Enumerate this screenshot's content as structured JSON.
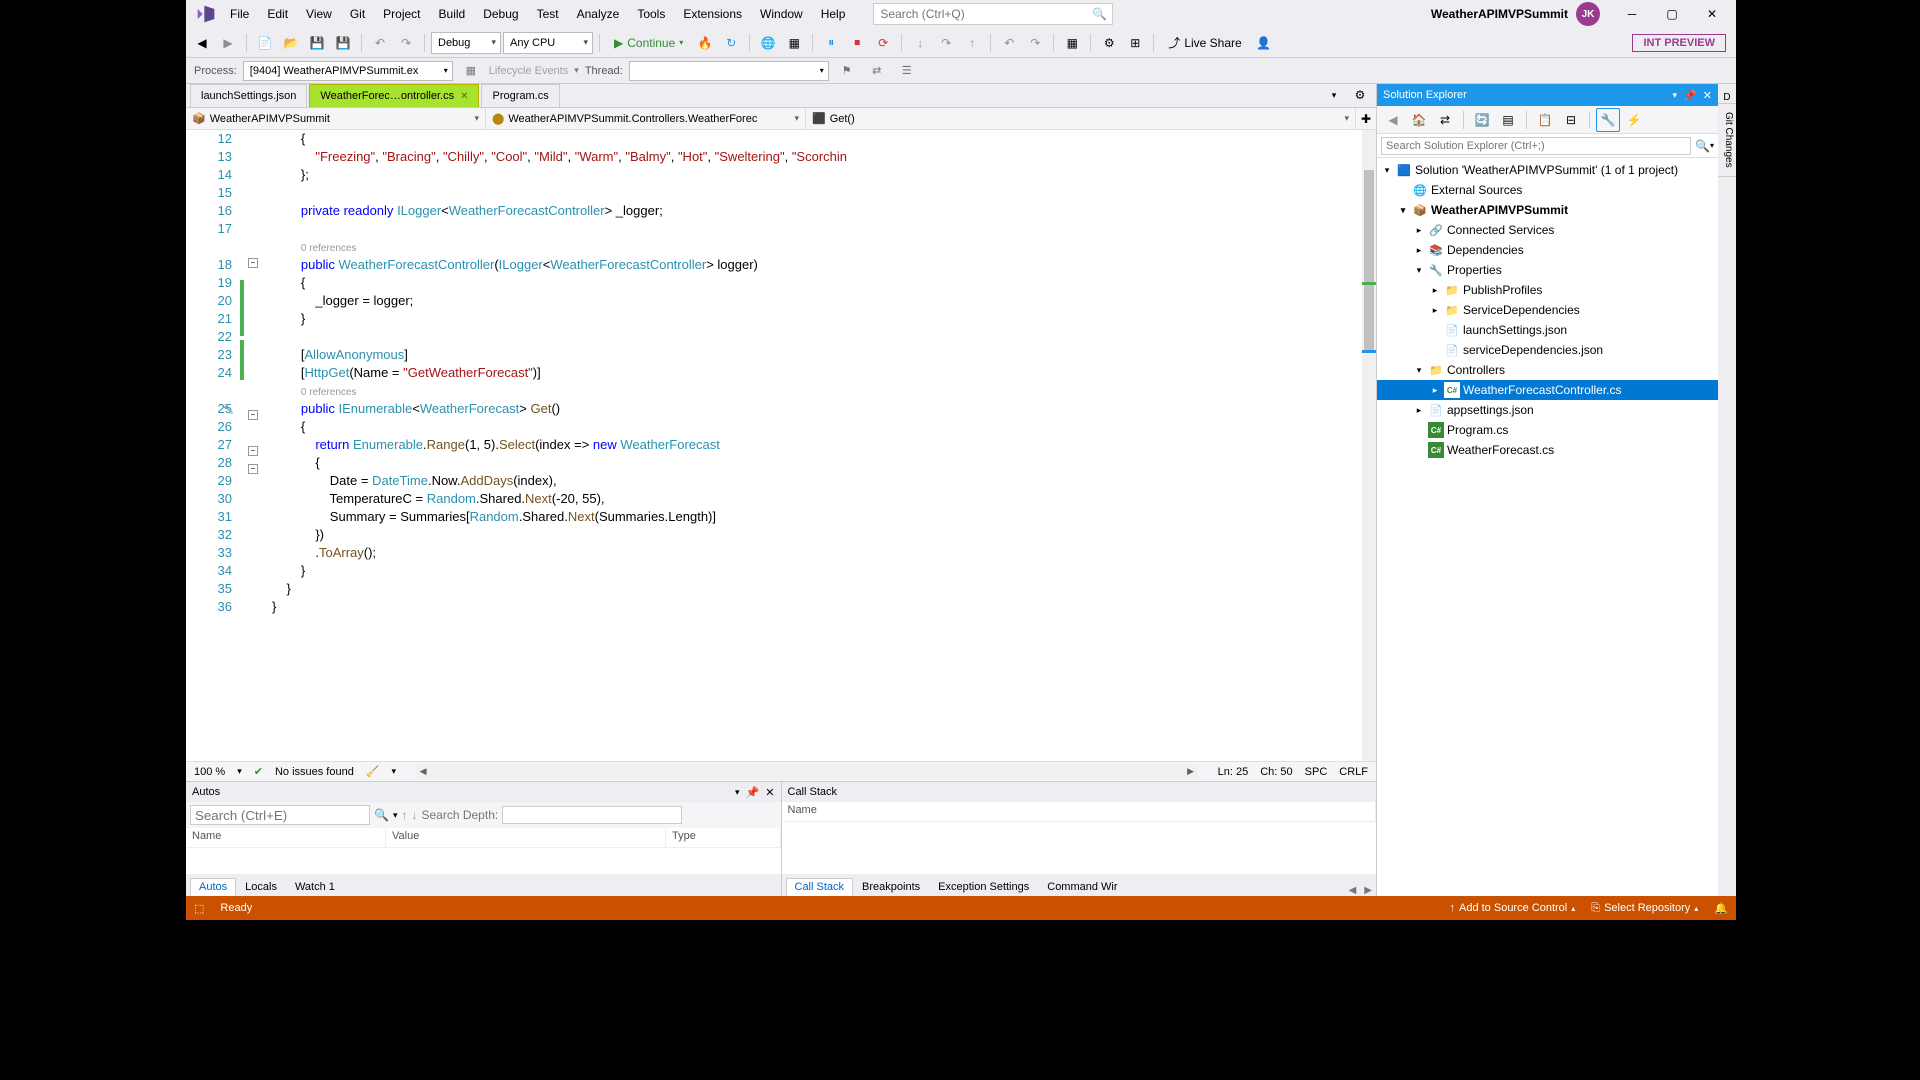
{
  "title": {
    "solution_display": "WeatherAPIMVPSummit",
    "user_initials": "JK"
  },
  "menus": [
    "File",
    "Edit",
    "View",
    "Git",
    "Project",
    "Build",
    "Debug",
    "Test",
    "Analyze",
    "Tools",
    "Extensions",
    "Window",
    "Help"
  ],
  "search": {
    "placeholder": "Search (Ctrl+Q)"
  },
  "toolbar": {
    "config": "Debug",
    "platform": "Any CPU",
    "continue": "Continue",
    "live_share": "Live Share",
    "int_preview": "INT PREVIEW"
  },
  "debugbar": {
    "process_label": "Process:",
    "process": "[9404] WeatherAPIMVPSummit.ex",
    "lifecycle": "Lifecycle Events",
    "thread_label": "Thread:"
  },
  "tabs": [
    {
      "label": "launchSettings.json",
      "active": false
    },
    {
      "label": "WeatherForec…ontroller.cs",
      "active": true
    },
    {
      "label": "Program.cs",
      "active": false
    }
  ],
  "navbar": {
    "scope": "WeatherAPIMVPSummit",
    "type": "WeatherAPIMVPSummit.Controllers.WeatherForec",
    "member": "Get()"
  },
  "code": {
    "lines": [
      {
        "n": 12,
        "html": "        {"
      },
      {
        "n": 13,
        "html": "            <span class='str'>\"Freezing\"</span>, <span class='str'>\"Bracing\"</span>, <span class='str'>\"Chilly\"</span>, <span class='str'>\"Cool\"</span>, <span class='str'>\"Mild\"</span>, <span class='str'>\"Warm\"</span>, <span class='str'>\"Balmy\"</span>, <span class='str'>\"Hot\"</span>, <span class='str'>\"Sweltering\"</span>, <span class='str'>\"Scorchin</span>"
      },
      {
        "n": 14,
        "html": "        };"
      },
      {
        "n": 15,
        "html": ""
      },
      {
        "n": 16,
        "html": "        <span class='kw'>private</span> <span class='kw'>readonly</span> <span class='type'>ILogger</span>&lt;<span class='type'>WeatherForecastController</span>&gt; _logger;"
      },
      {
        "n": 17,
        "html": ""
      },
      {
        "n": "",
        "html": "        <span class='ref'>0 references</span>"
      },
      {
        "n": 18,
        "html": "        <span class='kw'>public</span> <span class='type'>WeatherForecastController</span>(<span class='type'>ILogger</span>&lt;<span class='type'>WeatherForecastController</span>&gt; logger)"
      },
      {
        "n": 19,
        "html": "        {"
      },
      {
        "n": 20,
        "html": "            _logger = logger;"
      },
      {
        "n": 21,
        "html": "        }"
      },
      {
        "n": 22,
        "html": ""
      },
      {
        "n": 23,
        "html": "        [<span class='type'>AllowAnonymous</span>]"
      },
      {
        "n": 24,
        "html": "        [<span class='type'>HttpGet</span>(Name = <span class='str'>\"GetWeatherForecast\"</span>)]"
      },
      {
        "n": "",
        "html": "        <span class='ref'>0 references</span>"
      },
      {
        "n": 25,
        "html": "        <span class='kw'>public</span> <span class='type'>IEnumerable</span>&lt;<span class='type'>WeatherForecast</span>&gt; <span class='method'>Get</span>()"
      },
      {
        "n": 26,
        "html": "        {"
      },
      {
        "n": 27,
        "html": "            <span class='kw'>return</span> <span class='type'>Enumerable</span>.<span class='method'>Range</span>(1, 5).<span class='method'>Select</span>(index =&gt; <span class='kw'>new</span> <span class='type'>WeatherForecast</span>"
      },
      {
        "n": 28,
        "html": "            {"
      },
      {
        "n": 29,
        "html": "                Date = <span class='type'>DateTime</span>.Now.<span class='method'>AddDays</span>(index),"
      },
      {
        "n": 30,
        "html": "                TemperatureC = <span class='type'>Random</span>.Shared.<span class='method'>Next</span>(-20, 55),"
      },
      {
        "n": 31,
        "html": "                Summary = Summaries[<span class='type'>Random</span>.Shared.<span class='method'>Next</span>(Summaries.Length)]"
      },
      {
        "n": 32,
        "html": "            })"
      },
      {
        "n": 33,
        "html": "            .<span class='method'>ToArray</span>();"
      },
      {
        "n": 34,
        "html": "        }"
      },
      {
        "n": 35,
        "html": "    }"
      },
      {
        "n": 36,
        "html": "}"
      }
    ]
  },
  "editor_status": {
    "zoom": "100 %",
    "issues": "No issues found",
    "ln": "Ln: 25",
    "ch": "Ch: 50",
    "spc": "SPC",
    "crlf": "CRLF"
  },
  "autos": {
    "title": "Autos",
    "search_placeholder": "Search (Ctrl+E)",
    "depth_label": "Search Depth:",
    "cols": [
      "Name",
      "Value",
      "Type"
    ],
    "tabs": [
      "Autos",
      "Locals",
      "Watch 1"
    ]
  },
  "callstack": {
    "title": "Call Stack",
    "col": "Name",
    "tabs": [
      "Call Stack",
      "Breakpoints",
      "Exception Settings",
      "Command Wir"
    ]
  },
  "solution_explorer": {
    "title": "Solution Explorer",
    "search_placeholder": "Search Solution Explorer (Ctrl+;)",
    "root": "Solution 'WeatherAPIMVPSummit' (1 of 1 project)",
    "nodes": [
      {
        "indent": 1,
        "exp": "",
        "icon": "🌐",
        "label": "External Sources"
      },
      {
        "indent": 1,
        "exp": "▾",
        "icon": "📦",
        "label": "WeatherAPIMVPSummit",
        "bold": true
      },
      {
        "indent": 2,
        "exp": "▸",
        "icon": "🔗",
        "label": "Connected Services"
      },
      {
        "indent": 2,
        "exp": "▸",
        "icon": "📚",
        "label": "Dependencies"
      },
      {
        "indent": 2,
        "exp": "▾",
        "icon": "🔧",
        "label": "Properties"
      },
      {
        "indent": 3,
        "exp": "▸",
        "icon": "📁",
        "label": "PublishProfiles"
      },
      {
        "indent": 3,
        "exp": "▸",
        "icon": "📁",
        "label": "ServiceDependencies"
      },
      {
        "indent": 3,
        "exp": "",
        "icon": "📄",
        "label": "launchSettings.json"
      },
      {
        "indent": 3,
        "exp": "",
        "icon": "📄",
        "label": "serviceDependencies.json"
      },
      {
        "indent": 2,
        "exp": "▾",
        "icon": "📁",
        "label": "Controllers"
      },
      {
        "indent": 3,
        "exp": "▸",
        "icon": "C#",
        "label": "WeatherForecastController.cs",
        "selected": true
      },
      {
        "indent": 2,
        "exp": "▸",
        "icon": "📄",
        "label": "appsettings.json"
      },
      {
        "indent": 2,
        "exp": "",
        "icon": "C#",
        "label": "Program.cs"
      },
      {
        "indent": 2,
        "exp": "",
        "icon": "C#",
        "label": "WeatherForecast.cs"
      }
    ]
  },
  "side_tabs": [
    "D",
    "Git Changes"
  ],
  "statusbar": {
    "ready": "Ready",
    "add_source": "Add to Source Control",
    "select_repo": "Select Repository"
  }
}
